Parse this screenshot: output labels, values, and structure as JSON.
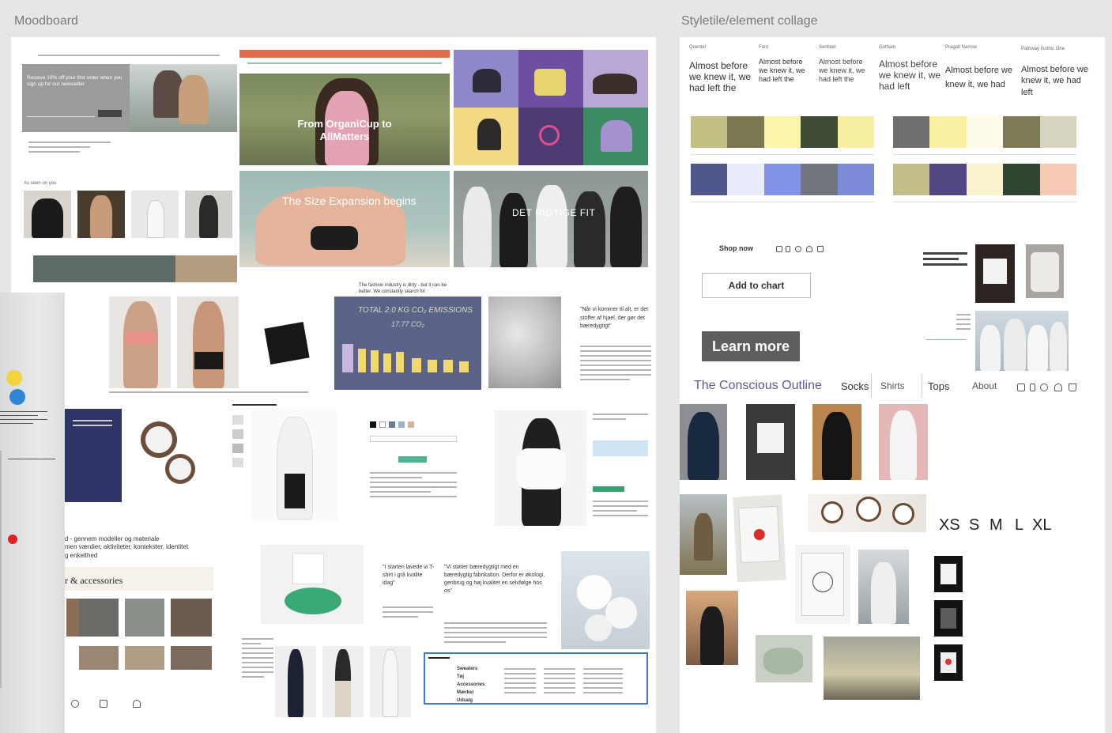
{
  "canvas": {
    "moodboard_label": "Moodboard",
    "styletile_label": "Styletile/element collage"
  },
  "moodboard": {
    "newsletter_text": "Receive 10% off your first order when you sign up for our newsletter",
    "hero_organicup": "From OrganiCup to AllMatters",
    "hero_size": "The Size Expansion begins",
    "hero_fit": "DET RIGTIGE FIT",
    "fashion_dirty": "The fashion industry is dirty - but it can be better. We constantly search for",
    "emissions_title": "TOTAL 2.0 KG CO₂ EMISSIONS",
    "emissions_sub": "17.77 CO₂",
    "quote_dansk": "\"Når vi kommer til alt, er det stoffer af hjael, der gør det bæredygtigt\"",
    "modeller_text": "d - gennem modeller og materiale\nmen værdier, aktiviteter, kontekster, identitet\ng enkelthed",
    "accessories_title": "r & accessories",
    "quote_tshirt": "\"I starten lavede vi T-shirt i grå kvalite idag\"",
    "quote_bæredygtig": "\"Vi støtter bæredygtigt med en bæredygtig fabrikation. Derfor er økologi, genbrug og høj kvalitet en selvfølge hos os\"",
    "menu_categories": [
      "Sweaters",
      "Tøj",
      "Accessories",
      "Mærker",
      "Udsalg"
    ]
  },
  "styletile": {
    "font_samples": [
      {
        "font": "Quentel",
        "text": "Almost before we knew it, we had left the"
      },
      {
        "font": "Font",
        "text": "Almost before we knew it, we had left the"
      },
      {
        "font": "Sentinel",
        "text": "Almost before we knew it, we had left the"
      },
      {
        "font": "Gotham",
        "text": "Almost before we knew it, we had left"
      },
      {
        "font": "Pragati Narrow",
        "text": "Almost before we knew it, we had"
      },
      {
        "font": "Pathway Gothic One",
        "text": "Almost before we knew it, we had left"
      }
    ],
    "palette_a_top": [
      "#c2c083",
      "#7c7852",
      "#fbf5ab",
      "#3f4a37",
      "#f5f0a0"
    ],
    "palette_a_bottom": [
      "#4f568c",
      "#e8ebfb",
      "#8193e8",
      "#72767c",
      "#7d8bd6"
    ],
    "palette_b_top": [
      "#707070",
      "#fbf1a3",
      "#fefce8",
      "#7d7a56",
      "#d6d3be"
    ],
    "palette_b_bottom": [
      "#c4bd8c",
      "#524783",
      "#f8f3cc",
      "#2f4431",
      "#f6c9b5"
    ],
    "shop_now": "Shop now",
    "add_to_chart": "Add to chart",
    "learn_more": "Learn more",
    "brand_name": "The Conscious Outline",
    "nav_items": [
      "Socks",
      "Shirts",
      "Tops"
    ],
    "about": "About",
    "sizes": [
      "XS",
      "S",
      "M",
      "L",
      "XL"
    ]
  },
  "colors": {
    "brand_purple": "#5c5a93",
    "learn_more_bg": "#5e5e5e",
    "cotton_white": "#f4f4f4"
  }
}
